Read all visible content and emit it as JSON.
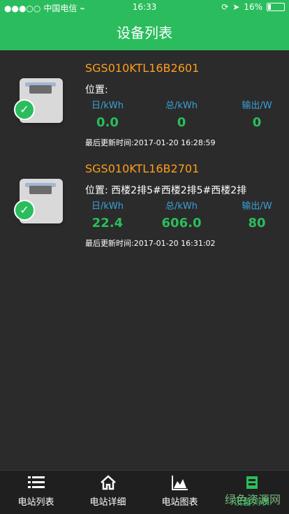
{
  "status_bar": {
    "signal": "●●●○○",
    "carrier": "中国电信",
    "time": "16:33",
    "battery": "16%",
    "battery_level": 0.16
  },
  "header": {
    "title": "设备列表"
  },
  "devices": [
    {
      "serial": "SGS010KTL16B2601",
      "location_label": "位置:",
      "location_value": "",
      "metrics": [
        {
          "label": "日/kWh",
          "value": "0.0"
        },
        {
          "label": "总/kWh",
          "value": "0"
        },
        {
          "label": "输出/W",
          "value": "0"
        }
      ],
      "updated_label": "最后更新时间:",
      "updated_value": "2017-01-20 16:28:59"
    },
    {
      "serial": "SGS010KTL16B2701",
      "location_label": "位置:",
      "location_value": "西楼2排5#西楼2排5#西楼2排",
      "metrics": [
        {
          "label": "日/kWh",
          "value": "22.4"
        },
        {
          "label": "总/kWh",
          "value": "606.0"
        },
        {
          "label": "输出/W",
          "value": "80"
        }
      ],
      "updated_label": "最后更新时间:",
      "updated_value": "2017-01-20 16:31:02"
    }
  ],
  "tabs": [
    {
      "label": "电站列表",
      "icon": "list-icon"
    },
    {
      "label": "电站详细",
      "icon": "home-icon"
    },
    {
      "label": "电站图表",
      "icon": "chart-icon"
    },
    {
      "label": "设备列表",
      "icon": "device-icon"
    }
  ],
  "watermark": "绿色资源网"
}
